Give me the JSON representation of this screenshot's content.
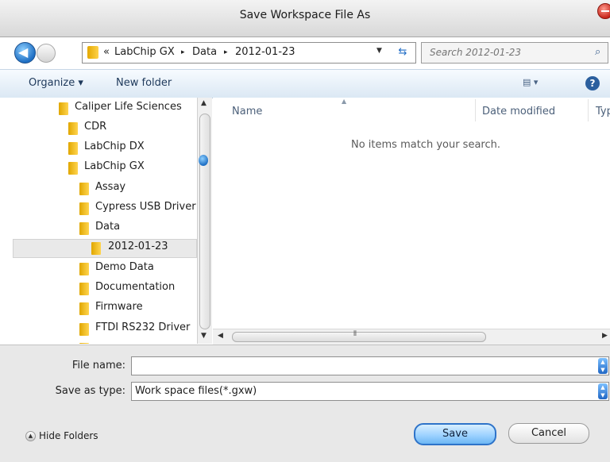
{
  "window": {
    "title": "Save Workspace File As"
  },
  "address": {
    "overflow": "«",
    "crumbs": [
      "LabChip GX",
      "Data",
      "2012-01-23"
    ],
    "separator": "▸"
  },
  "search": {
    "placeholder": "Search 2012-01-23"
  },
  "toolbar": {
    "organize": "Organize ▾",
    "new_folder": "New folder",
    "views": "▤ ▾",
    "help": "?"
  },
  "tree": {
    "items": [
      {
        "label": "Caliper Life Sciences"
      },
      {
        "label": "CDR"
      },
      {
        "label": "LabChip DX"
      },
      {
        "label": "LabChip GX"
      },
      {
        "label": "Assay"
      },
      {
        "label": "Cypress USB Driver"
      },
      {
        "label": "Data"
      },
      {
        "label": "2012-01-23",
        "selected": true
      },
      {
        "label": "Demo Data"
      },
      {
        "label": "Documentation"
      },
      {
        "label": "Firmware"
      },
      {
        "label": "FTDI RS232 Driver"
      }
    ]
  },
  "list": {
    "columns": [
      "Name",
      "Date modified",
      "Typ"
    ],
    "empty_message": "No items match your search."
  },
  "form": {
    "file_name_label": "File name:",
    "file_name_value": "",
    "save_type_label": "Save as type:",
    "save_type_value": "Work space files(*.gxw)"
  },
  "buttons": {
    "hide_folders": "Hide Folders",
    "save": "Save",
    "cancel": "Cancel"
  }
}
